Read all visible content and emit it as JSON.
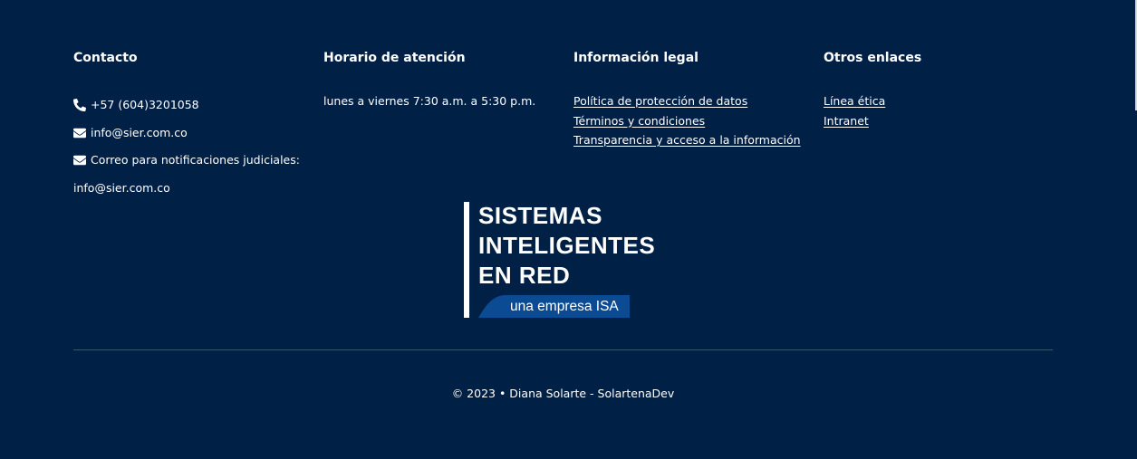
{
  "contacto": {
    "title": "Contacto",
    "phone_icon": "phone-icon",
    "phone": "+57 (604)3201058",
    "email_icon": "envelope-icon",
    "email": "info@sier.com.co",
    "judicial_label": "Correo para notificaciones judiciales:",
    "judicial_email": "info@sier.com.co"
  },
  "horario": {
    "title": "Horario de atención",
    "text": "lunes a viernes 7:30 a.m. a 5:30 p.m."
  },
  "legal": {
    "title": "Información legal",
    "links": [
      "Política de protección de datos",
      "Términos y condiciones",
      "Transparencia y acceso a la información"
    ]
  },
  "otros": {
    "title": "Otros enlaces",
    "links": [
      "Línea ética",
      "Intranet"
    ]
  },
  "logo": {
    "line1": "SISTEMAS",
    "line2": "INTELIGENTES",
    "line3": "EN RED",
    "tagline": "una empresa ISA"
  },
  "copyright": "© 2023 • Diana Solarte - SolartenaDev",
  "colors": {
    "background": "#002046",
    "logo_tag": "#0a4b93",
    "divider": "#3d5670"
  }
}
